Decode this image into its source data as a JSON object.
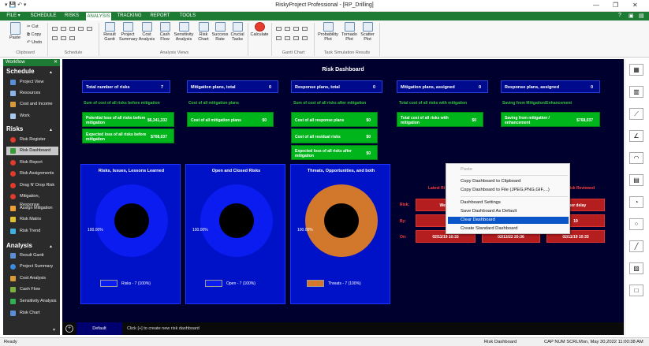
{
  "window": {
    "title": "RiskyProject Professional - [RP_Drilling]",
    "help": "?"
  },
  "menu_tabs": [
    "FILE ▾",
    "SCHEDULE",
    "RISKS",
    "ANALYSIS",
    "TRACKING",
    "REPORT",
    "TOOLS"
  ],
  "ribbon": {
    "clipboard": {
      "paste": "Paste",
      "cut": "Cut",
      "copy": "Copy",
      "undo": "Undo",
      "group": "Clipboard"
    },
    "schedule_group": "Schedule",
    "views": [
      "Result Gantt",
      "Project Summary",
      "Cost Analysis",
      "Cash Flow",
      "Sensitivity Analysis",
      "Risk Chart",
      "Success Rate",
      "Crucial Tasks"
    ],
    "views_group": "Analysis Views",
    "calculate": "Calculate",
    "gantt_group": "Gantt Chart",
    "plots": [
      "Probability Plot",
      "Tornado Plot",
      "Scatter Plot"
    ],
    "plots_group": "Task Simulation Results"
  },
  "sidebar": {
    "header": "Workflow",
    "schedule": {
      "title": "Schedule",
      "items": [
        "Project View",
        "Resources",
        "Cost and Income",
        "Work"
      ]
    },
    "risks": {
      "title": "Risks",
      "items": [
        "Risk Register",
        "Risk Dashboard",
        "Risk Report",
        "Risk Assignments",
        "Drag N' Drop Risk",
        "Mitigation, Response",
        "Assign Mitigation",
        "Risk Matrix",
        "Risk Trend"
      ]
    },
    "analysis": {
      "title": "Analysis",
      "items": [
        "Result Gantt",
        "Project Summary",
        "Cost Analysis",
        "Cash Flow",
        "Sensitivity Analysis",
        "Risk Chart"
      ]
    }
  },
  "dashboard": {
    "title": "Risk Dashboard",
    "cards": [
      {
        "label": "Total number of risks",
        "value": "7"
      },
      {
        "label": "Mitigation plans, total",
        "value": "0"
      },
      {
        "label": "Response plans, total",
        "value": "0"
      },
      {
        "label": "Mitigation plans, assigned",
        "value": "0"
      },
      {
        "label": "Response plans, assigned",
        "value": "0"
      }
    ],
    "section_labels": [
      "Sum of cost of all risks before mitigation",
      "Cost of all mitigation plans",
      "Sum of cost of all risks after mitigation",
      "Total cost of all risks with mitigation",
      "Saving from Mitigation/Enhancement"
    ],
    "green": [
      {
        "label": "Potential loss of all risks before mitigation",
        "value": "$6,341,332"
      },
      {
        "label": "Expected loss of all risks before mitigation",
        "value": "$768,037"
      },
      {
        "label": "Cost of all mitigation plans",
        "value": "$0"
      },
      {
        "label": "Cost of all response plans",
        "value": "$0"
      },
      {
        "label": "Cost of all residual risks",
        "value": "$0"
      },
      {
        "label": "Expected loss of all risks after mitigation",
        "value": "$0"
      },
      {
        "label": "Total cost of all risks with mitigation",
        "value": "$0"
      },
      {
        "label": "Saving from mitigation / enhancement",
        "value": "$768,037"
      }
    ],
    "panels": [
      {
        "title": "Risks, Issues, Lessons Learned",
        "pct": "100.00%",
        "legend": "Risks - 7 (100%)",
        "color": "#0a1cf0"
      },
      {
        "title": "Open and Closed Risks",
        "pct": "100.00%",
        "legend": "Open - 7 (100%)",
        "color": "#0a1cf0"
      },
      {
        "title": "Threats, Opportunities, and both",
        "pct": "100.00%",
        "legend": "Threats - 7 (100%)",
        "color": "#d2782d"
      }
    ],
    "latest": {
      "label_risk": "Risk:",
      "label_by": "By:",
      "label_on": "On:",
      "title_left": "Latest Ri",
      "title_right": "Risk Reviewed",
      "col1": {
        "risk": "Weath",
        "on": "02/11/19 10:33"
      },
      "col2": {
        "on": "02/13/22 20:36"
      },
      "col3": {
        "risk": "ather delay",
        "by": "19",
        "on": "02/11/19 10:33"
      }
    }
  },
  "context_menu": [
    "Paste",
    "Copy Dashboard to Clipboard",
    "Copy Dashboard to File (JPEG,PNG,GIF,...)",
    "Dashboard Settings",
    "Save Dashboard As Default",
    "Clear Dashboard",
    "Create Standard Dashboard"
  ],
  "bottom_tabs": {
    "add": "+",
    "default": "Default",
    "hint": "Click [+] to create new risk dashboard"
  },
  "status": {
    "left": "Ready",
    "view": "Risk Dashboard",
    "flags": "CAP  NUM  SCRL",
    "datetime": "Mon, May 30,2022 11:00:38 AM"
  }
}
